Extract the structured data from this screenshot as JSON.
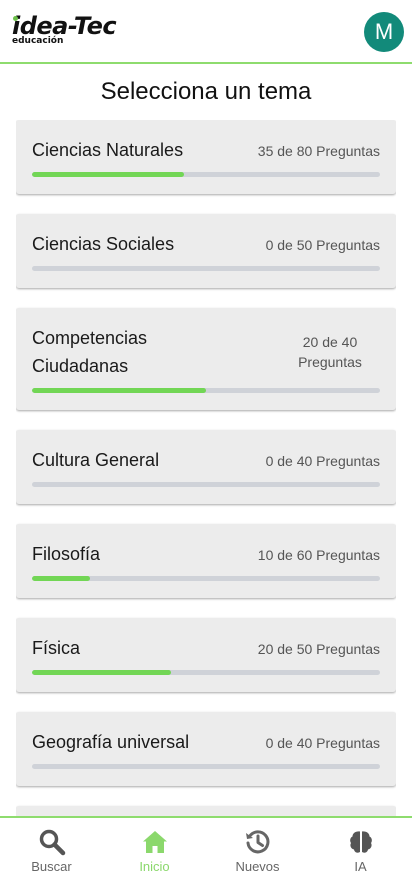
{
  "app": {
    "logo_main": "idea-Tec",
    "logo_sub": "educación",
    "avatar_initial": "M",
    "avatar_color": "#128a7a",
    "accent": "#72d655"
  },
  "page": {
    "title": "Selecciona un tema"
  },
  "topics": [
    {
      "name": "Ciencias Naturales",
      "count": "35 de 80 Preguntas",
      "progress": 0.4375
    },
    {
      "name": "Ciencias Sociales",
      "count": "0 de 50 Preguntas",
      "progress": 0
    },
    {
      "name": "Competencias Ciudadanas",
      "count": "20 de 40 Preguntas",
      "progress": 0.5
    },
    {
      "name": "Cultura General",
      "count": "0 de 40 Preguntas",
      "progress": 0
    },
    {
      "name": "Filosofía",
      "count": "10 de 60 Preguntas",
      "progress": 0.1667
    },
    {
      "name": "Física",
      "count": "20 de 50 Preguntas",
      "progress": 0.4
    },
    {
      "name": "Geografía universal",
      "count": "0 de 40 Preguntas",
      "progress": 0
    }
  ],
  "nav": {
    "active": "inicio",
    "items": [
      {
        "key": "buscar",
        "label": "Buscar",
        "icon": "search-icon"
      },
      {
        "key": "inicio",
        "label": "Inicio",
        "icon": "home-icon"
      },
      {
        "key": "nuevos",
        "label": "Nuevos",
        "icon": "history-icon"
      },
      {
        "key": "ia",
        "label": "IA",
        "icon": "brain-icon"
      }
    ]
  }
}
